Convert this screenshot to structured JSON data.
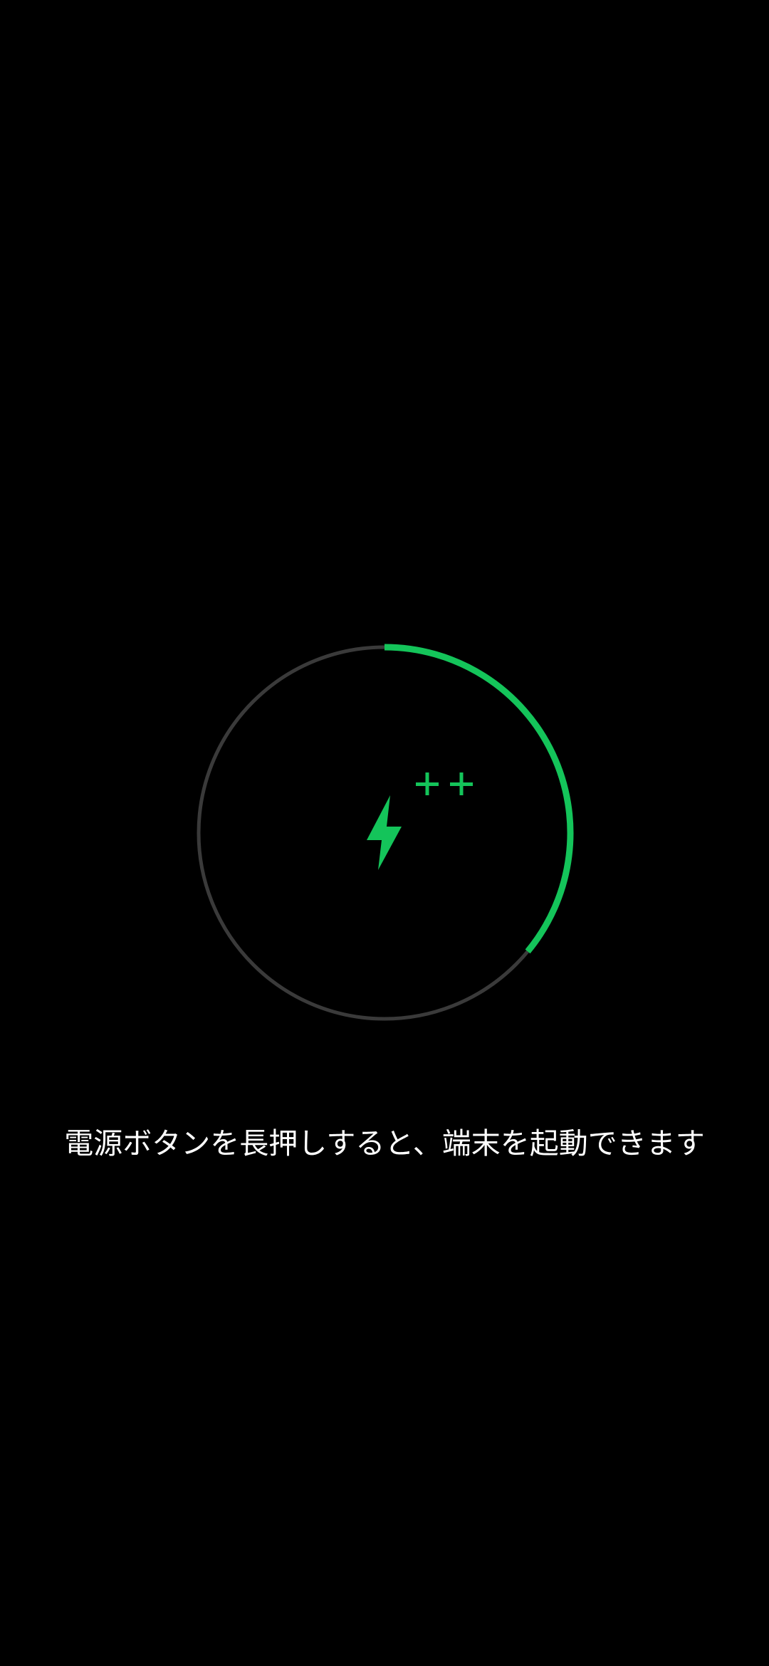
{
  "charging": {
    "level_fraction": 0.36,
    "icon": "lightning-bolt-icon",
    "fast_charge_indicator": "++",
    "accent_color": "#14c45a",
    "track_color": "#3a3a3a",
    "background_color": "#000000"
  },
  "hint": {
    "text": "電源ボタンを長押しすると、端末を起動できます"
  }
}
